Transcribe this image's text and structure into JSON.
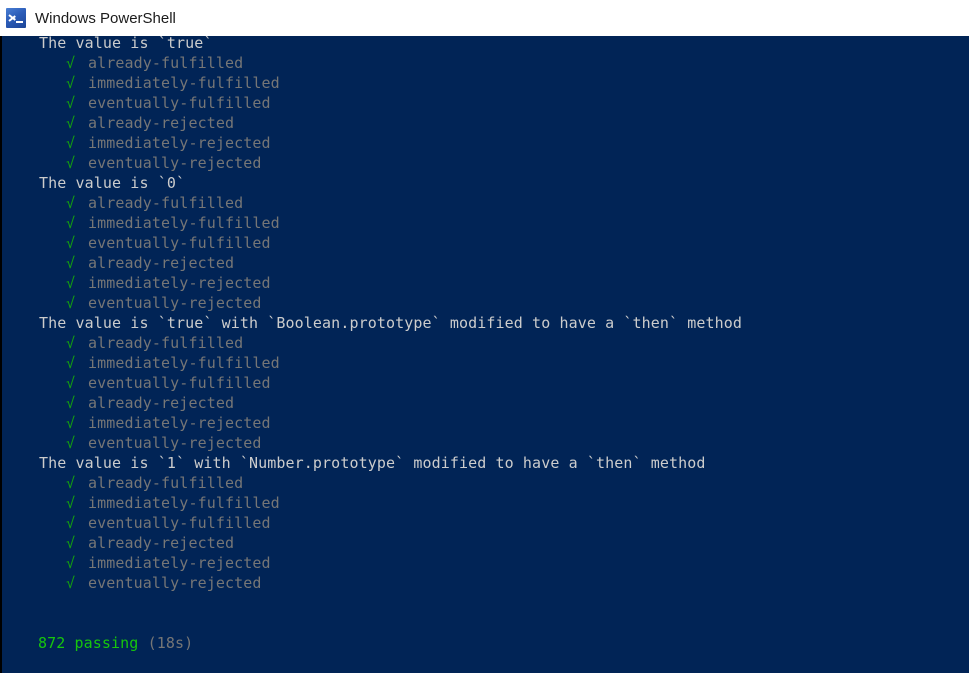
{
  "window": {
    "title": "Windows PowerShell",
    "icon": "powershell-icon",
    "titlebar_background": "#ffffff",
    "titlebar_text_color": "#1b1b1b"
  },
  "console": {
    "background": "#012456",
    "suite_text_color": "#cccccc",
    "test_text_color": "#767676",
    "check_color": "#13a10e",
    "pass_count_color": "#16c60c",
    "check_glyph": "√",
    "groups": [
      {
        "title": "The value is `true`",
        "tests": [
          "already-fulfilled",
          "immediately-fulfilled",
          "eventually-fulfilled",
          "already-rejected",
          "immediately-rejected",
          "eventually-rejected"
        ]
      },
      {
        "title": "The value is `0`",
        "tests": [
          "already-fulfilled",
          "immediately-fulfilled",
          "eventually-fulfilled",
          "already-rejected",
          "immediately-rejected",
          "eventually-rejected"
        ]
      },
      {
        "title": "The value is `true` with `Boolean.prototype` modified to have a `then` method",
        "tests": [
          "already-fulfilled",
          "immediately-fulfilled",
          "eventually-fulfilled",
          "already-rejected",
          "immediately-rejected",
          "eventually-rejected"
        ]
      },
      {
        "title": "The value is `1` with `Number.prototype` modified to have a `then` method",
        "tests": [
          "already-fulfilled",
          "immediately-fulfilled",
          "eventually-fulfilled",
          "already-rejected",
          "immediately-rejected",
          "eventually-rejected"
        ]
      }
    ],
    "blank_lines_before_summary": 2,
    "summary": {
      "count_text": "872 passing",
      "duration_text": "(18s)"
    }
  }
}
